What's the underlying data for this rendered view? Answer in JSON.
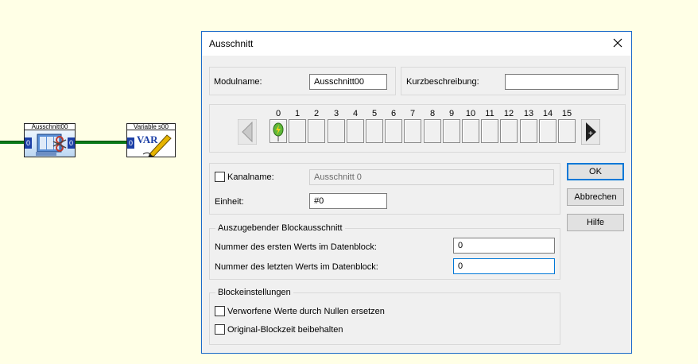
{
  "worksheet": {
    "module1": {
      "title": "Ausschnitt00",
      "in_port": "0",
      "out_port": "0",
      "icon": "scissors-icon"
    },
    "module2": {
      "title": "Variable s00",
      "in_port": "0",
      "icon": "var-pen-icon",
      "icon_text": "VAR"
    }
  },
  "dialog": {
    "title": "Ausschnitt",
    "modulname_label": "Modulname:",
    "modulname_value": "Ausschnitt00",
    "kurzbeschreibung_label": "Kurzbeschreibung:",
    "kurzbeschreibung_value": "",
    "channels": [
      "0",
      "1",
      "2",
      "3",
      "4",
      "5",
      "6",
      "7",
      "8",
      "9",
      "10",
      "11",
      "12",
      "13",
      "14",
      "15"
    ],
    "active_channel": 0,
    "kanalname_label": "Kanalname:",
    "kanalname_value": "Ausschnitt 0",
    "einheit_label": "Einheit:",
    "einheit_value": "#0",
    "block_group": {
      "legend": "Auszugebender Blockausschnitt",
      "first_label": "Nummer des ersten Werts im Datenblock:",
      "first_value": "0",
      "last_label": "Nummer des letzten Werts im Datenblock:",
      "last_value": "0"
    },
    "settings_group": {
      "legend": "Blockeinstellungen",
      "option1": "Verworfene Werte durch Nullen ersetzen",
      "option2": "Original-Blockzeit beibehalten"
    },
    "buttons": {
      "ok": "OK",
      "cancel": "Abbrechen",
      "help": "Hilfe"
    }
  },
  "colors": {
    "accent": "#0078d7",
    "wire": "#0a7a18",
    "port": "#1c3fa6",
    "canvas": "#FFFFE6"
  }
}
